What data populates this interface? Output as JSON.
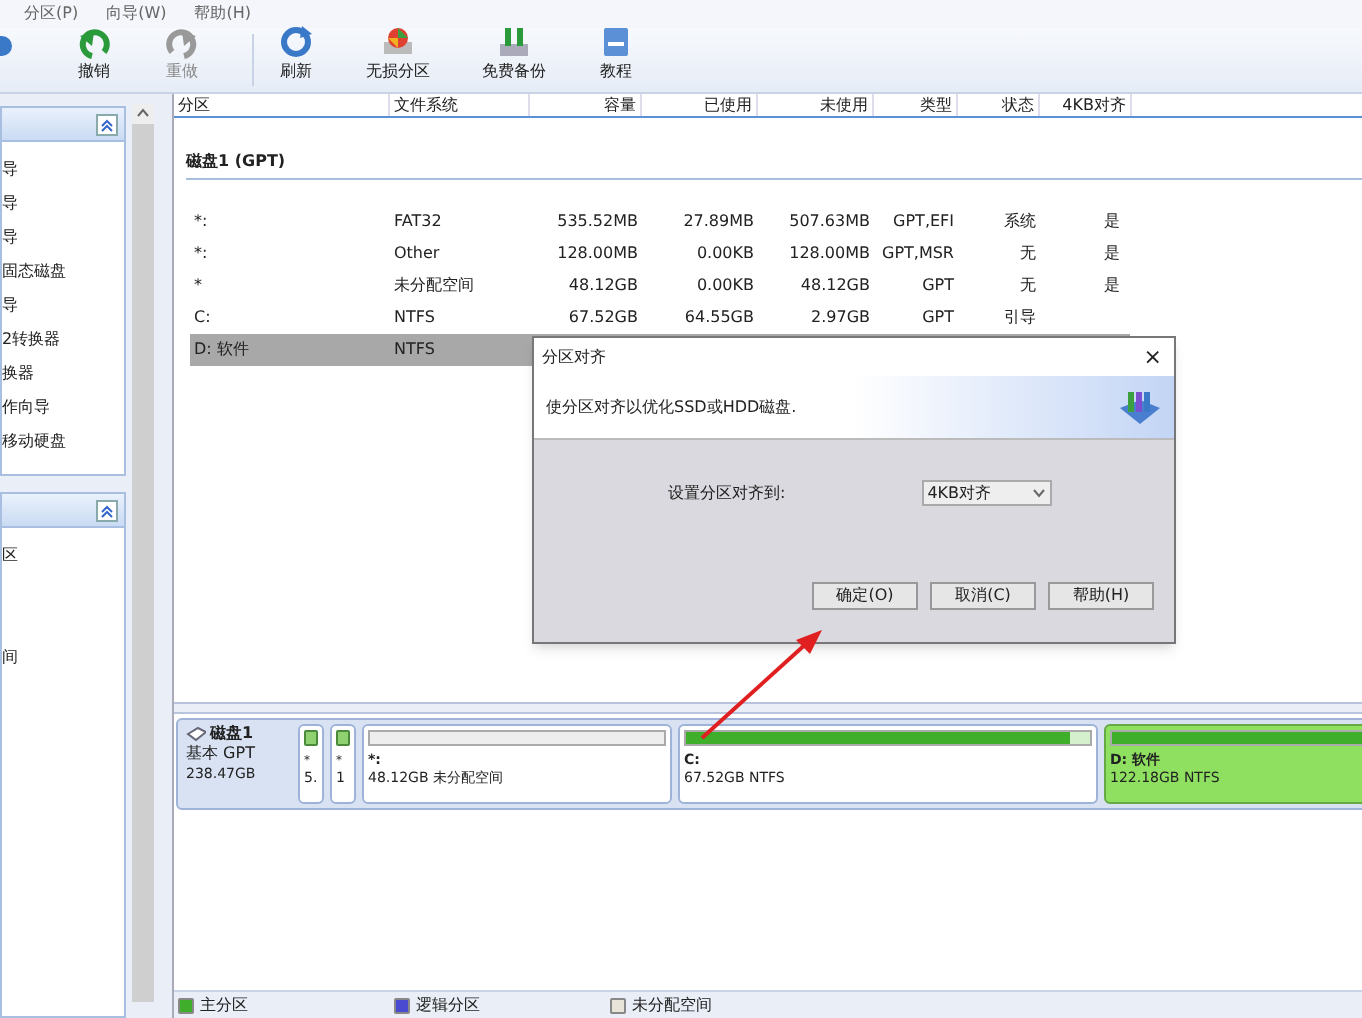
{
  "menu": [
    {
      "label": "分区(P)"
    },
    {
      "label": "向导(W)"
    },
    {
      "label": "帮助(H)"
    }
  ],
  "toolbar": [
    {
      "label": "撤销",
      "disabled": false
    },
    {
      "label": "重做",
      "disabled": true
    },
    {
      "label": "刷新",
      "disabled": false
    },
    {
      "label": "无损分区",
      "disabled": false
    },
    {
      "label": "免费备份",
      "disabled": false
    },
    {
      "label": "教程",
      "disabled": false
    }
  ],
  "sidebar": {
    "panels": [
      {
        "items": [
          "导",
          "导",
          "导",
          "固态磁盘",
          "导",
          "2转换器",
          "换器",
          "作向导",
          "移动硬盘"
        ]
      },
      {
        "items": [
          "区",
          "间"
        ]
      }
    ]
  },
  "table": {
    "columns": [
      "分区",
      "文件系统",
      "容量",
      "已使用",
      "未使用",
      "类型",
      "状态",
      "4KB对齐"
    ],
    "disk": "磁盘1 (GPT)",
    "rows": [
      {
        "cells": [
          "*:",
          "FAT32",
          "535.52MB",
          "27.89MB",
          "507.63MB",
          "GPT,EFI",
          "系统",
          "是"
        ],
        "selected": false
      },
      {
        "cells": [
          "*:",
          "Other",
          "128.00MB",
          "0.00KB",
          "128.00MB",
          "GPT,MSR",
          "无",
          "是"
        ],
        "selected": false
      },
      {
        "cells": [
          "*",
          "未分配空间",
          "48.12GB",
          "0.00KB",
          "48.12GB",
          "GPT",
          "无",
          "是"
        ],
        "selected": false
      },
      {
        "cells": [
          "C:",
          "NTFS",
          "67.52GB",
          "64.55GB",
          "2.97GB",
          "GPT",
          "引导",
          ""
        ],
        "selected": false
      },
      {
        "cells": [
          "D: 软件",
          "NTFS",
          "",
          "",
          "",
          "",
          "",
          ""
        ],
        "selected": true
      }
    ]
  },
  "dialog": {
    "title": "分区对齐",
    "close": "×",
    "description": "使分区对齐以优化SSD或HDD磁盘.",
    "field_label": "设置分区对齐到:",
    "value": "4KB对齐",
    "buttons": [
      "确定(O)",
      "取消(C)",
      "帮助(H)"
    ]
  },
  "disk_map": {
    "name": "磁盘1",
    "type": "基本 GPT",
    "size": "238.47GB",
    "partitions": [
      {
        "kind": "narrow",
        "label": "*",
        "info": "5.",
        "selected": false
      },
      {
        "kind": "narrow",
        "label": "*",
        "info": "1",
        "selected": false
      },
      {
        "kind": "unallocated",
        "label": "*:",
        "info": "48.12GB 未分配空间",
        "selected": false
      },
      {
        "kind": "primary",
        "label": "C:",
        "info": "67.52GB NTFS",
        "level": 0.95,
        "selected": false
      },
      {
        "kind": "primary",
        "label": "D: 软件",
        "info": "122.18GB NTFS",
        "level": 1,
        "selected": true
      }
    ]
  },
  "legend": [
    {
      "label": "主分区",
      "color": "#3fae2a"
    },
    {
      "label": "逻辑分区",
      "color": "#4a4ad0"
    },
    {
      "label": "未分配空间",
      "color": "#e8e4d8"
    }
  ]
}
